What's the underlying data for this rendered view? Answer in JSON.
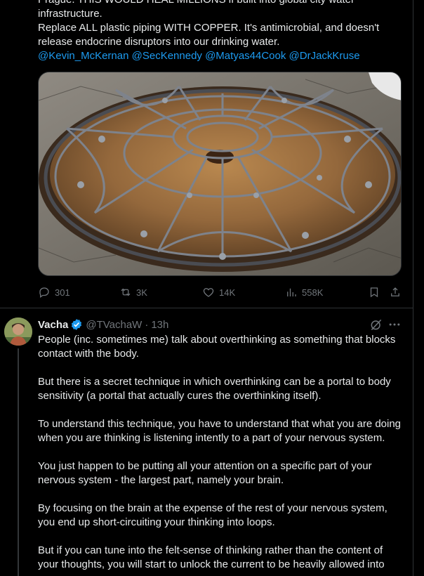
{
  "tweet1": {
    "text_lines": [
      "Prague. THIS WOULD HEAL MILLIONS if built into global city water",
      "infrastructure.",
      "Replace ALL plastic piping WITH COPPER. It's antimicrobial, and doesn't",
      "release endocrine disruptors into our drinking water."
    ],
    "mentions": "@Kevin_McKernan @SecKennedy @Matyas44Cook @DrJackKruse",
    "actions": {
      "replies": "301",
      "reposts": "3K",
      "likes": "14K",
      "views": "558K"
    }
  },
  "tweet2": {
    "name": "Vacha",
    "handle": "@TVachaW",
    "separator": "·",
    "time": "13h",
    "paragraphs": [
      "People (inc. sometimes me) talk about overthinking as something that blocks contact with the body.",
      "But there is a secret technique in which overthinking can be a portal to body sensitivity (a portal that actually cures the overthinking itself).",
      "To understand this technique, you have to understand that what you are doing when you are thinking is listening intently to a part of your nervous system.",
      "You just happen to be putting all your attention on a specific part of your nervous system - the largest part, namely your brain.",
      "By focusing on the brain at the expense of the rest of your nervous system, you end up short-circuiting your thinking into loops.",
      "But if you can tune into the felt-sense of thinking rather than the content of your thoughts, you will start to unlock the current to be heavily allowed into"
    ]
  },
  "colors": {
    "background": "#000000",
    "text": "#e7e9ea",
    "muted": "#71767b",
    "accent": "#1d9bf0",
    "border": "#2f3336"
  },
  "icons": [
    "reply-icon",
    "repost-icon",
    "like-icon",
    "views-icon",
    "bookmark-icon",
    "share-icon",
    "verified-badge-icon",
    "grok-icon",
    "more-icon"
  ]
}
